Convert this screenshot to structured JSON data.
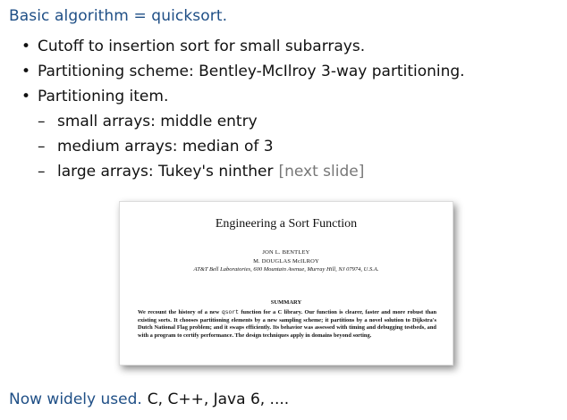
{
  "heading": "Basic algorithm = quicksort.",
  "bullets": [
    {
      "text": "Cutoff to insertion sort for small subarrays."
    },
    {
      "text": "Partitioning scheme:  Bentley-McIlroy 3-way partitioning."
    },
    {
      "text": "Partitioning item."
    }
  ],
  "sub_bullets": [
    {
      "text": "small arrays:  middle entry",
      "note": ""
    },
    {
      "text": "medium arrays:  median of 3",
      "note": ""
    },
    {
      "text": "large arrays: Tukey's ninther",
      "note": "[next slide]"
    }
  ],
  "paper": {
    "title": "Engineering a Sort Function",
    "author1": "JON L. BENTLEY",
    "author2": "M. DOUGLAS McILROY",
    "affiliation": "AT&T Bell Laboratories, 600 Mountain Avenue, Murray Hill, NJ 07974, U.S.A.",
    "summary_heading": "SUMMARY",
    "abstract_pre": "We recount the history of a new ",
    "abstract_code": "qsort",
    "abstract_post": " function for a C library.  Our function is clearer, faster and more robust than existing sorts.  It chooses partitioning elements by a new sampling scheme; it partitions by a novel solution to Dijkstra's Dutch National Flag problem; and it swaps efficiently.  Its behavior was assessed with timing and debugging testbeds, and with a program to certify performance.  The design techniques apply in domains beyond sorting."
  },
  "footer": {
    "lead": "Now widely used.",
    "tail": "C, C++, Java 6, ...."
  },
  "colors": {
    "accent": "#1f4f86",
    "note_grey": "#777777"
  }
}
